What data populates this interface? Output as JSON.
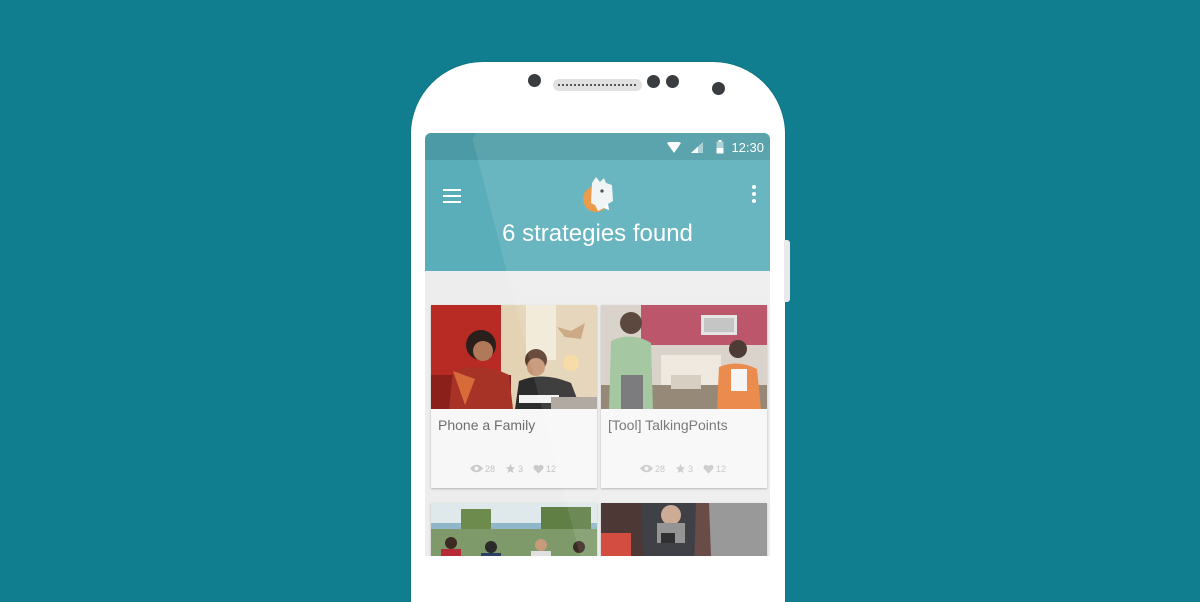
{
  "status_bar": {
    "time": "12:30"
  },
  "app_bar": {
    "title": "6 strategies found"
  },
  "cards": [
    {
      "title": "Phone a Family",
      "views": "28",
      "stars": "3",
      "likes": "12"
    },
    {
      "title": "[Tool] TalkingPoints",
      "views": "28",
      "stars": "3",
      "likes": "12"
    }
  ],
  "icons": {
    "wifi": "wifi-icon",
    "signal": "signal-icon",
    "battery": "battery-icon",
    "menu": "hamburger-menu-icon",
    "more": "more-vert-icon",
    "views": "eye-icon",
    "stars": "star-icon",
    "likes": "heart-icon"
  },
  "colors": {
    "background": "#117e8f",
    "status_bar": "#4b9aa5",
    "app_bar": "#5aaeba",
    "screen_bg": "#ededed"
  }
}
